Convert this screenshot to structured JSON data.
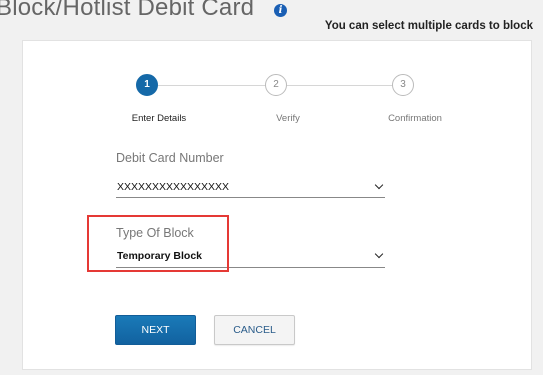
{
  "header": {
    "title": "Block/Hotlist Debit Card",
    "info_icon": "info-icon",
    "note": "You can select multiple cards to block"
  },
  "stepper": {
    "steps": [
      {
        "number": "1",
        "label": "Enter Details",
        "active": true
      },
      {
        "number": "2",
        "label": "Verify",
        "active": false
      },
      {
        "number": "3",
        "label": "Confirmation",
        "active": false
      }
    ]
  },
  "form": {
    "card_number": {
      "label": "Debit Card Number",
      "value": "XXXXXXXXXXXXXXXX"
    },
    "block_type": {
      "label": "Type Of Block",
      "value": "Temporary Block"
    }
  },
  "buttons": {
    "next": "NEXT",
    "cancel": "CANCEL"
  },
  "colors": {
    "accent": "#1569a8",
    "highlight": "#e53935"
  }
}
